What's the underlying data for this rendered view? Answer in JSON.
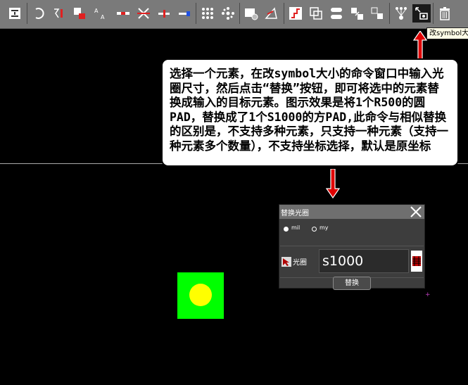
{
  "toolbar": {
    "tools": [
      {
        "icon": "align-icon"
      },
      {
        "icon": "rotate-icon"
      },
      {
        "icon": "mirror-icon"
      },
      {
        "icon": "flip-icon"
      },
      {
        "icon": "text-size-icon"
      },
      {
        "icon": "line-icon"
      },
      {
        "icon": "cut-cross-icon"
      },
      {
        "icon": "line-end-icon"
      },
      {
        "icon": "line-split-icon"
      },
      {
        "icon": "dot-grid-icon"
      },
      {
        "icon": "dot-array-icon"
      },
      {
        "icon": "symbol-icon"
      },
      {
        "icon": "angle-icon"
      },
      {
        "icon": "step-icon"
      },
      {
        "icon": "copy-icon"
      },
      {
        "icon": "replace-icon"
      },
      {
        "icon": "move-icon"
      },
      {
        "icon": "transfer-icon"
      },
      {
        "icon": "tree-icon"
      },
      {
        "icon": "change-symbol-size-icon"
      },
      {
        "icon": "delete-icon"
      }
    ],
    "tooltip": "改symbol大小"
  },
  "callout": {
    "text": "选择一个元素，在改symbol大小的命令窗口中输入光圈尺寸，然后点击“替换”按钮，即可将选中的元素替换成输入的目标元素。图示效果是将1个R500的圆PAD，替换成了1个S1000的方PAD,此命令与相似替换的区别是，不支持多种元素，只支持一种元素（支持一种元素多个数量），不支持坐标选择，默认是原坐标"
  },
  "dialog": {
    "title": "替换光圈",
    "unit_options": [
      {
        "label": "mil",
        "selected": true
      },
      {
        "label": "my",
        "selected": false
      }
    ],
    "aperture_label": "光圈",
    "aperture_value": "s1000",
    "replace_button": "替换"
  },
  "colors": {
    "arrow": "#e00000",
    "pad_square": "#00ff00",
    "pad_circle": "#ffff00"
  }
}
